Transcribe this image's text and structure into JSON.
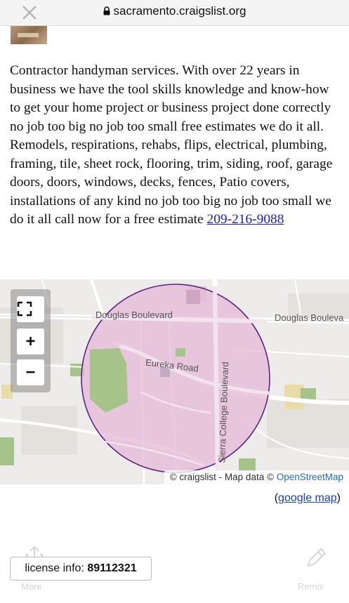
{
  "browser": {
    "url": "sacramento.craigslist.org"
  },
  "listing": {
    "description_1": "Contractor handyman services. With over 22 years in business we have the tool skills knowledge and know-how to get your home project or business project done correctly no job too big no job too small free estimates we do it all.",
    "description_2": "Remodels, respirations, rehabs, flips, electrical, plumbing, framing, tile, sheet rock, flooring, trim, siding, roof, garage doors, doors, windows, decks, fences, Patio covers, installations of any kind no job too big no job too small we do it all call now for a free estimate",
    "phone": "209-216-9088"
  },
  "map": {
    "controls": {
      "fullscreen": "⛶",
      "zoom_in": "+",
      "zoom_out": "−"
    },
    "labels": {
      "douglas_1": "Douglas Boulevard",
      "douglas_2": "Douglas Bouleva",
      "eureka": "Eureka Road",
      "sierra": "Sierra College Boulevard"
    },
    "attribution_prefix": "© craigslist - Map data ©",
    "attribution_link": "OpenStreetMap",
    "colors": {
      "circle_fill": "#e4b8d8",
      "circle_stroke": "#5a2580",
      "park": "#a6c48a"
    }
  },
  "google_map": {
    "open": "(",
    "link": "google map",
    "close": ")"
  },
  "license": {
    "label": "license info:",
    "number": "89112321"
  },
  "overlay": {
    "more": "More",
    "remix": "Remix"
  }
}
